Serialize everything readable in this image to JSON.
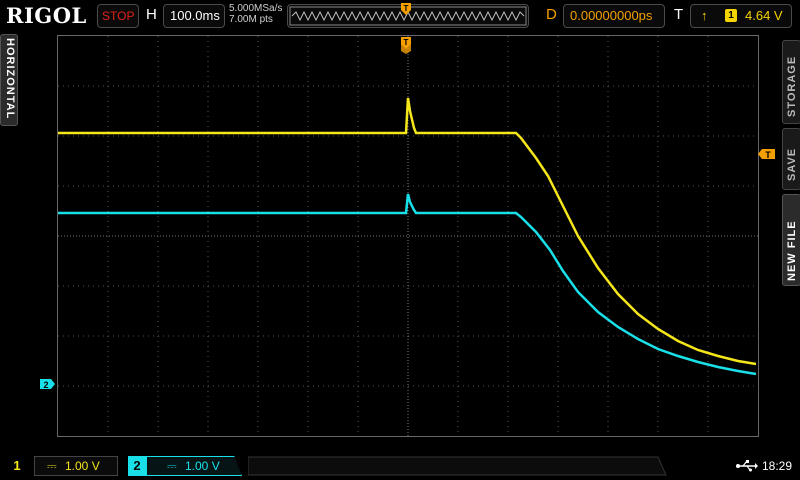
{
  "header": {
    "brand": "RIGOL",
    "run_state": "STOP",
    "h_label": "H",
    "timebase": "100.0ms",
    "sample_rate": "5.000MSa/s",
    "memory_depth": "7.00M pts",
    "delay_label": "D",
    "delay": "0.00000000ps",
    "trigger_label": "T",
    "trigger_edge": "↑",
    "trigger_source": "1",
    "trigger_level": "4.64 V"
  },
  "side_tabs": {
    "horizontal": "HORIZONTAL",
    "storage": "STORAGE",
    "save": "SAVE",
    "new_file": "NEW FILE"
  },
  "markers": {
    "ch2_marker": "2",
    "trigger_level_marker": "T",
    "trigger_pos_marker": "T"
  },
  "channels": [
    {
      "num": "1",
      "coupling": "⎓",
      "scale": "1.00 V",
      "color": "#f5e51b"
    },
    {
      "num": "2",
      "coupling": "⎓",
      "scale": "1.00 V",
      "color": "#19e0e8"
    }
  ],
  "status": {
    "usb": "⭠",
    "time": "18:29"
  },
  "colors": {
    "ch1": "#f5e51b",
    "ch2": "#19e0e8",
    "trigger": "#f5a000",
    "stop": "#e2231a"
  }
}
